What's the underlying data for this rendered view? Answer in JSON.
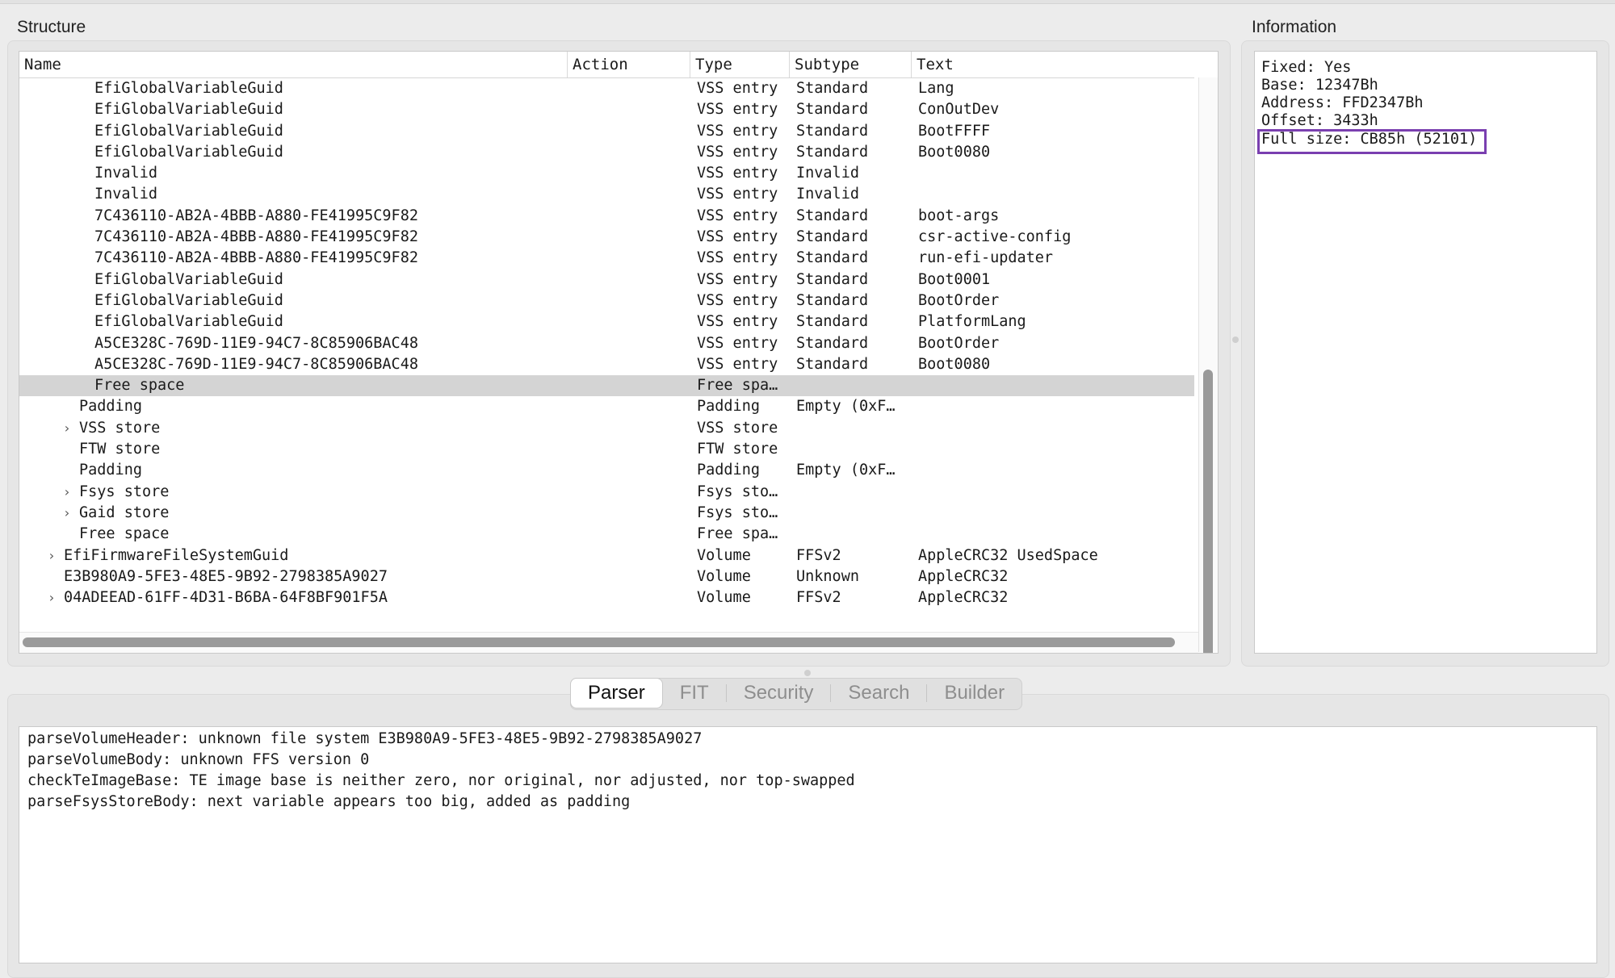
{
  "structure": {
    "title": "Structure",
    "columns": [
      "Name",
      "Action",
      "Type",
      "Subtype",
      "Text"
    ],
    "rows": [
      {
        "name": "EfiGlobalVariableGuid",
        "indent": 3,
        "expander": false,
        "action": "",
        "type": "VSS entry",
        "subtype": "Standard",
        "text": "Lang",
        "selected": false
      },
      {
        "name": "EfiGlobalVariableGuid",
        "indent": 3,
        "expander": false,
        "action": "",
        "type": "VSS entry",
        "subtype": "Standard",
        "text": "ConOutDev",
        "selected": false
      },
      {
        "name": "EfiGlobalVariableGuid",
        "indent": 3,
        "expander": false,
        "action": "",
        "type": "VSS entry",
        "subtype": "Standard",
        "text": "BootFFFF",
        "selected": false
      },
      {
        "name": "EfiGlobalVariableGuid",
        "indent": 3,
        "expander": false,
        "action": "",
        "type": "VSS entry",
        "subtype": "Standard",
        "text": "Boot0080",
        "selected": false
      },
      {
        "name": "Invalid",
        "indent": 3,
        "expander": false,
        "action": "",
        "type": "VSS entry",
        "subtype": "Invalid",
        "text": "",
        "selected": false
      },
      {
        "name": "Invalid",
        "indent": 3,
        "expander": false,
        "action": "",
        "type": "VSS entry",
        "subtype": "Invalid",
        "text": "",
        "selected": false
      },
      {
        "name": "7C436110-AB2A-4BBB-A880-FE41995C9F82",
        "indent": 3,
        "expander": false,
        "action": "",
        "type": "VSS entry",
        "subtype": "Standard",
        "text": "boot-args",
        "selected": false
      },
      {
        "name": "7C436110-AB2A-4BBB-A880-FE41995C9F82",
        "indent": 3,
        "expander": false,
        "action": "",
        "type": "VSS entry",
        "subtype": "Standard",
        "text": "csr-active-config",
        "selected": false
      },
      {
        "name": "7C436110-AB2A-4BBB-A880-FE41995C9F82",
        "indent": 3,
        "expander": false,
        "action": "",
        "type": "VSS entry",
        "subtype": "Standard",
        "text": "run-efi-updater",
        "selected": false
      },
      {
        "name": "EfiGlobalVariableGuid",
        "indent": 3,
        "expander": false,
        "action": "",
        "type": "VSS entry",
        "subtype": "Standard",
        "text": "Boot0001",
        "selected": false
      },
      {
        "name": "EfiGlobalVariableGuid",
        "indent": 3,
        "expander": false,
        "action": "",
        "type": "VSS entry",
        "subtype": "Standard",
        "text": "BootOrder",
        "selected": false
      },
      {
        "name": "EfiGlobalVariableGuid",
        "indent": 3,
        "expander": false,
        "action": "",
        "type": "VSS entry",
        "subtype": "Standard",
        "text": "PlatformLang",
        "selected": false
      },
      {
        "name": "A5CE328C-769D-11E9-94C7-8C85906BAC48",
        "indent": 3,
        "expander": false,
        "action": "",
        "type": "VSS entry",
        "subtype": "Standard",
        "text": "BootOrder",
        "selected": false
      },
      {
        "name": "A5CE328C-769D-11E9-94C7-8C85906BAC48",
        "indent": 3,
        "expander": false,
        "action": "",
        "type": "VSS entry",
        "subtype": "Standard",
        "text": "Boot0080",
        "selected": false
      },
      {
        "name": "Free space",
        "indent": 3,
        "expander": false,
        "action": "",
        "type": "Free spa…",
        "subtype": "",
        "text": "",
        "selected": true
      },
      {
        "name": "Padding",
        "indent": 2,
        "expander": false,
        "action": "",
        "type": "Padding",
        "subtype": "Empty (0xF…",
        "text": "",
        "selected": false
      },
      {
        "name": "VSS store",
        "indent": 2,
        "expander": true,
        "action": "",
        "type": "VSS store",
        "subtype": "",
        "text": "",
        "selected": false
      },
      {
        "name": "FTW store",
        "indent": 2,
        "expander": false,
        "action": "",
        "type": "FTW store",
        "subtype": "",
        "text": "",
        "selected": false
      },
      {
        "name": "Padding",
        "indent": 2,
        "expander": false,
        "action": "",
        "type": "Padding",
        "subtype": "Empty (0xF…",
        "text": "",
        "selected": false
      },
      {
        "name": "Fsys store",
        "indent": 2,
        "expander": true,
        "action": "",
        "type": "Fsys sto…",
        "subtype": "",
        "text": "",
        "selected": false
      },
      {
        "name": "Gaid store",
        "indent": 2,
        "expander": true,
        "action": "",
        "type": "Fsys sto…",
        "subtype": "",
        "text": "",
        "selected": false
      },
      {
        "name": "Free space",
        "indent": 2,
        "expander": false,
        "action": "",
        "type": "Free spa…",
        "subtype": "",
        "text": "",
        "selected": false
      },
      {
        "name": "EfiFirmwareFileSystemGuid",
        "indent": 1,
        "expander": true,
        "action": "",
        "type": "Volume",
        "subtype": "FFSv2",
        "text": "AppleCRC32 UsedSpace",
        "selected": false
      },
      {
        "name": "E3B980A9-5FE3-48E5-9B92-2798385A9027",
        "indent": 1,
        "expander": false,
        "action": "",
        "type": "Volume",
        "subtype": "Unknown",
        "text": "AppleCRC32",
        "selected": false
      },
      {
        "name": "04ADEEAD-61FF-4D31-B6BA-64F8BF901F5A",
        "indent": 1,
        "expander": true,
        "action": "",
        "type": "Volume",
        "subtype": "FFSv2",
        "text": "AppleCRC32",
        "selected": false
      }
    ]
  },
  "information": {
    "title": "Information",
    "lines": [
      "Fixed: Yes",
      "Base: 12347Bh",
      "Address: FFD2347Bh",
      "Offset: 3433h"
    ],
    "highlighted": "Full size: CB85h (52101)",
    "highlight_color": "#7a3fb0"
  },
  "tabs": [
    {
      "label": "Parser",
      "active": true
    },
    {
      "label": "FIT",
      "active": false
    },
    {
      "label": "Security",
      "active": false
    },
    {
      "label": "Search",
      "active": false
    },
    {
      "label": "Builder",
      "active": false
    }
  ],
  "messages": [
    "parseVolumeHeader: unknown file system E3B980A9-5FE3-48E5-9B92-2798385A9027",
    "parseVolumeBody: unknown FFS version 0",
    "checkTeImageBase: TE image base is neither zero, nor original, nor adjusted, nor top-swapped",
    "parseFsysStoreBody: next variable appears too big, added as padding"
  ],
  "icons": {
    "expander": "chevron-right-icon"
  }
}
